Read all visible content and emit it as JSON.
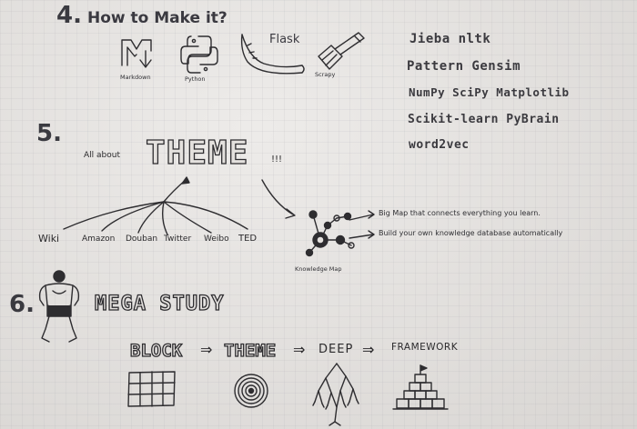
{
  "section4": {
    "number": "4.",
    "title": "How to Make it?",
    "icons": [
      {
        "icon": "markdown-icon",
        "label": "Markdown"
      },
      {
        "icon": "python-icon",
        "label": "Python"
      },
      {
        "icon": "flask-horn-icon",
        "label": "Flask"
      },
      {
        "icon": "scrapy-spatula-icon",
        "label": "Scrapy"
      }
    ],
    "libraries": [
      "Jieba nltk",
      "Pattern Gensim",
      "NumPy SciPy Matplotlib",
      "Scikit-learn PyBrain",
      "word2vec"
    ]
  },
  "section5": {
    "number": "5.",
    "prefix": "All about",
    "theme": "THEME",
    "exclaim": "!!!",
    "sources": [
      "Wiki",
      "Amazon",
      "Douban",
      "Twitter",
      "Weibo",
      "TED"
    ],
    "map_label": "Knowledge Map",
    "notes": [
      "Big Map that connects everything you learn.",
      "Build your own knowledge database automatically"
    ]
  },
  "section6": {
    "number": "6.",
    "title": "MEGA STUDY",
    "flow": [
      "BLOCK",
      "THEME",
      "DEEP",
      "FRAMEWORK"
    ],
    "arrow": "⇒",
    "arrow2": "⇒",
    "arrow3": "⇒"
  }
}
